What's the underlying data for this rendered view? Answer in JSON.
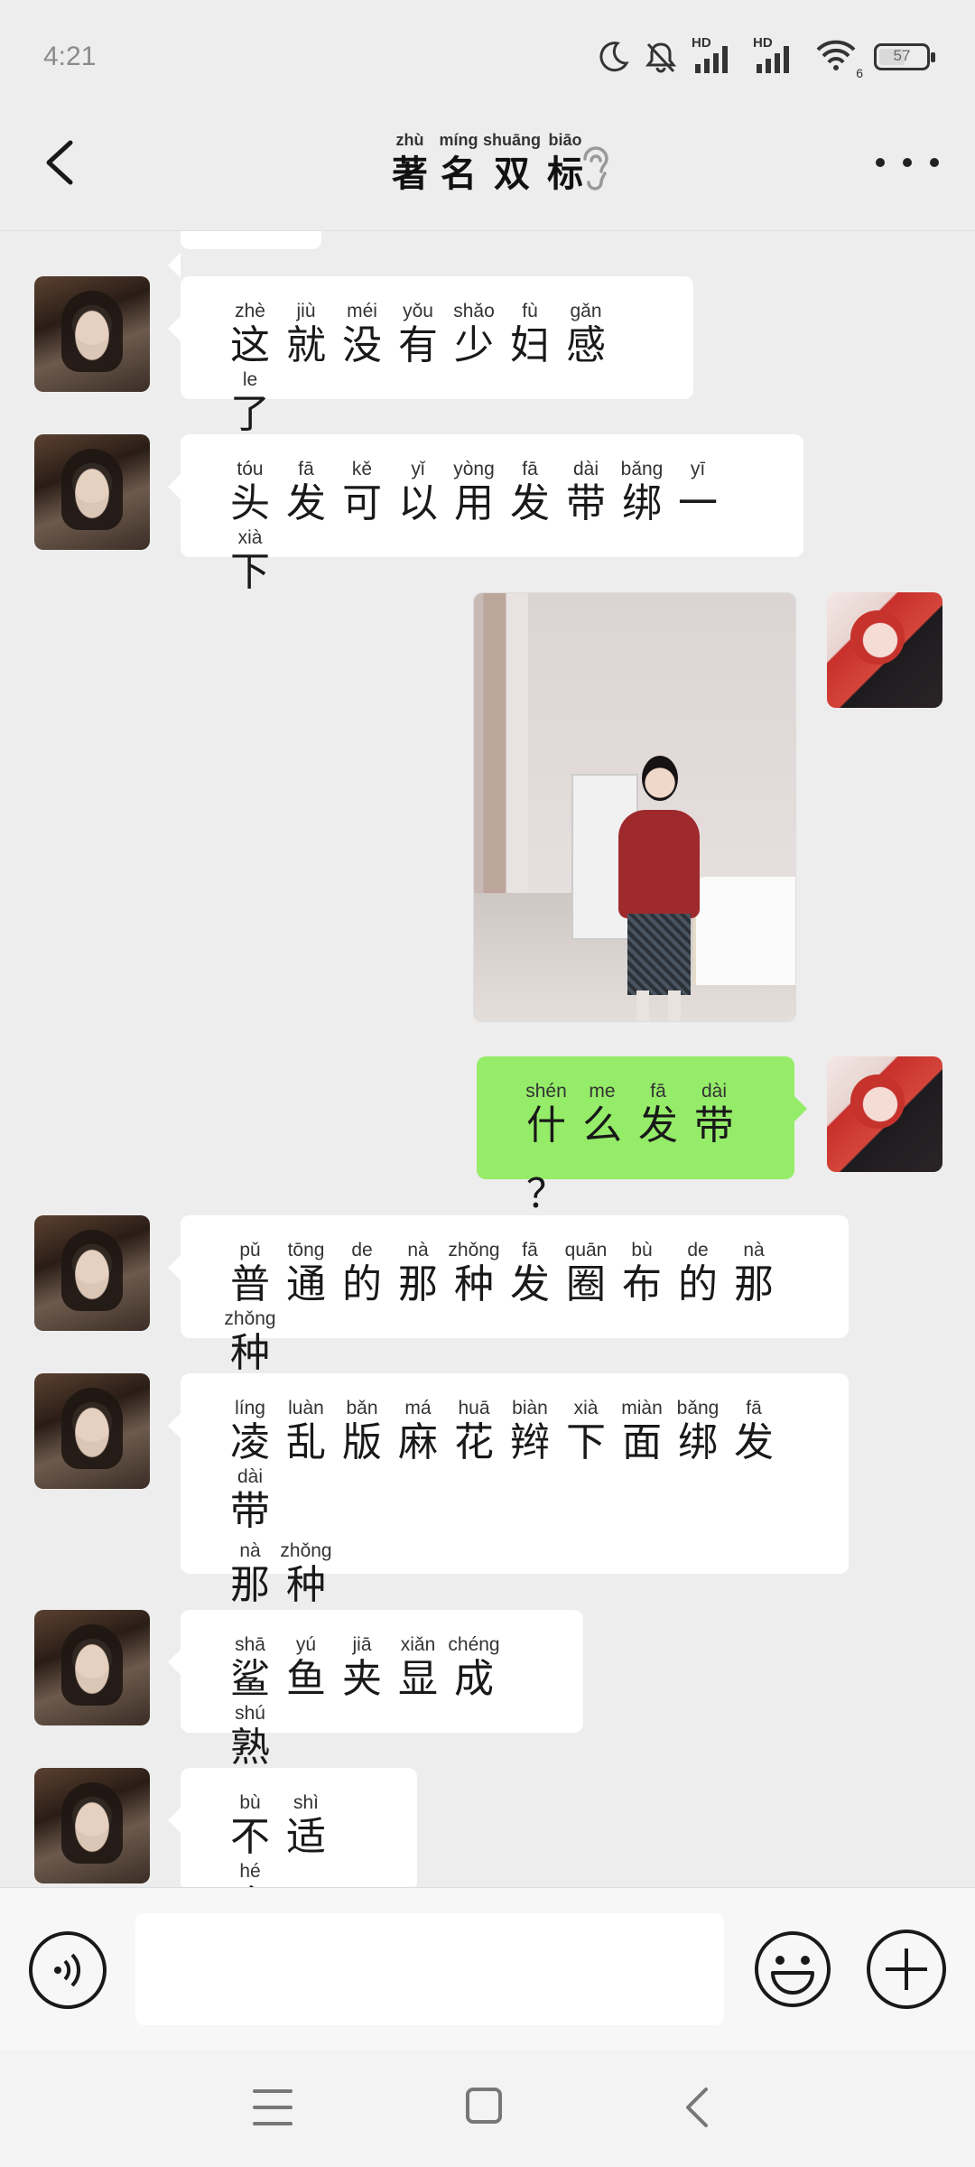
{
  "status_bar": {
    "time": "4:21",
    "network_label_1": "HD",
    "network_label_2": "HD",
    "wifi_badge": "6",
    "battery_text": "57",
    "battery_level": 0.57
  },
  "header": {
    "title_chars": [
      "著",
      "名",
      "双",
      "标"
    ],
    "title_pinyin": [
      "zhù",
      "míng",
      "shuāng",
      "biāo"
    ]
  },
  "messages": [
    {
      "side": "left",
      "lines": [
        [
          [
            "这",
            "zhè"
          ],
          [
            "就",
            "jiù"
          ],
          [
            "没",
            "méi"
          ],
          [
            "有",
            "yǒu"
          ],
          [
            "少",
            "shǎo"
          ],
          [
            "妇",
            "fù"
          ],
          [
            "感",
            "gǎn"
          ],
          [
            "了",
            "le"
          ]
        ]
      ]
    },
    {
      "side": "left",
      "lines": [
        [
          [
            "头",
            "tóu"
          ],
          [
            "发",
            "fā"
          ],
          [
            "可",
            "kě"
          ],
          [
            "以",
            "yǐ"
          ],
          [
            "用",
            "yòng"
          ],
          [
            "发",
            "fā"
          ],
          [
            "带",
            "dài"
          ],
          [
            "绑",
            "bǎng"
          ],
          [
            "一",
            "yī"
          ],
          [
            "下",
            "xià"
          ]
        ]
      ]
    },
    {
      "side": "right",
      "type": "image"
    },
    {
      "side": "right",
      "lines": [
        [
          [
            "什",
            "shén"
          ],
          [
            "么",
            "me"
          ],
          [
            "发",
            "fā"
          ],
          [
            "带",
            "dài"
          ],
          [
            "？",
            ""
          ]
        ]
      ]
    },
    {
      "side": "left",
      "lines": [
        [
          [
            "普",
            "pǔ"
          ],
          [
            "通",
            "tōng"
          ],
          [
            "的",
            "de"
          ],
          [
            "那",
            "nà"
          ],
          [
            "种",
            "zhǒng"
          ],
          [
            "发",
            "fā"
          ],
          [
            "圈",
            "quān"
          ],
          [
            "布",
            "bù"
          ],
          [
            "的",
            "de"
          ],
          [
            "那",
            "nà"
          ],
          [
            "种",
            "zhǒng"
          ]
        ]
      ]
    },
    {
      "side": "left",
      "lines": [
        [
          [
            "凌",
            "líng"
          ],
          [
            "乱",
            "luàn"
          ],
          [
            "版",
            "bǎn"
          ],
          [
            "麻",
            "má"
          ],
          [
            "花",
            "huā"
          ],
          [
            "辫",
            "biàn"
          ],
          [
            "下",
            "xià"
          ],
          [
            "面",
            "miàn"
          ],
          [
            "绑",
            "bǎng"
          ],
          [
            "发",
            "fā"
          ],
          [
            "带",
            "dài"
          ]
        ],
        [
          [
            "那",
            "nà"
          ],
          [
            "种",
            "zhǒng"
          ]
        ]
      ]
    },
    {
      "side": "left",
      "lines": [
        [
          [
            "鲨",
            "shā"
          ],
          [
            "鱼",
            "yú"
          ],
          [
            "夹",
            "jiā"
          ],
          [
            "显",
            "xiǎn"
          ],
          [
            "成",
            "chéng"
          ],
          [
            "熟",
            "shú"
          ]
        ]
      ]
    },
    {
      "side": "left",
      "lines": [
        [
          [
            "不",
            "bù"
          ],
          [
            "适",
            "shì"
          ],
          [
            "合",
            "hé"
          ]
        ]
      ]
    }
  ],
  "input": {
    "value": "",
    "placeholder": ""
  },
  "icons": {
    "back": "chevron-left-icon",
    "ear": "ear-icon",
    "more": "more-dots-icon",
    "voice": "voice-icon",
    "emoji": "emoji-icon",
    "plus": "plus-icon",
    "nav_menu": "menu-icon",
    "nav_home": "home-icon",
    "nav_back": "back-icon"
  },
  "colors": {
    "chat_bg": "#ededed",
    "my_bubble": "#95ec69",
    "their_bubble": "#ffffff"
  }
}
